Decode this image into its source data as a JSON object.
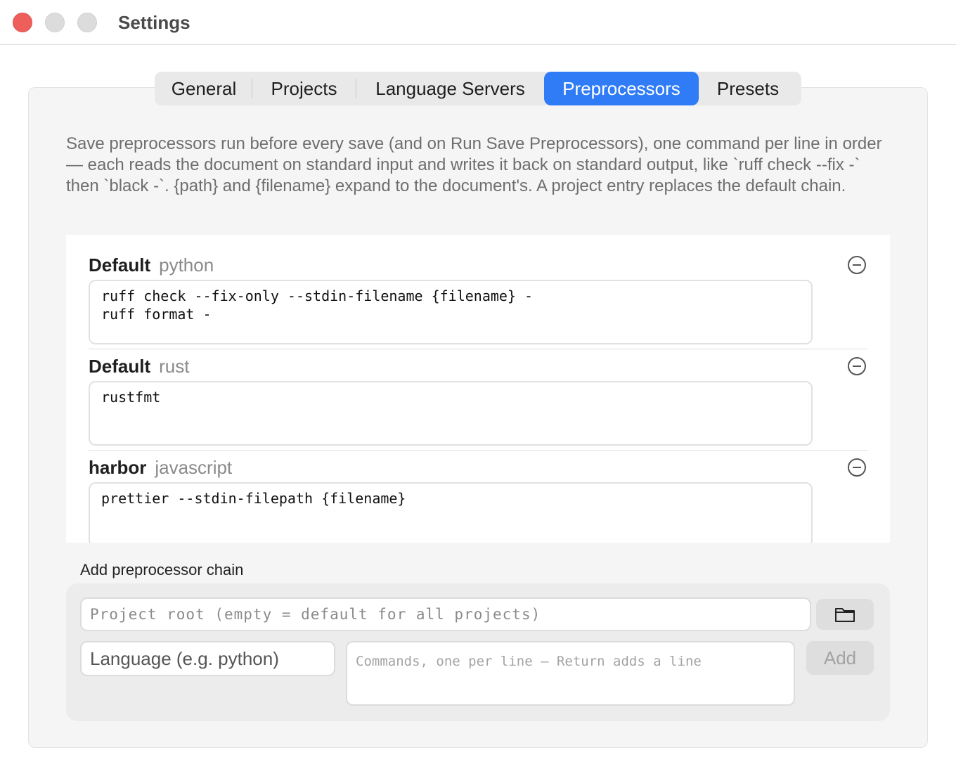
{
  "window": {
    "title": "Settings"
  },
  "tabs": [
    {
      "label": "General"
    },
    {
      "label": "Projects"
    },
    {
      "label": "Language Servers"
    },
    {
      "label": "Preprocessors"
    },
    {
      "label": "Presets"
    }
  ],
  "active_tab": "Preprocessors",
  "description": "Save preprocessors run before every save (and on Run Save Preprocessors), one command per line in order — each reads the document on standard input and writes it back on standard output, like `ruff check --fix -` then `black -`. {path} and {filename} expand to the document's. A project entry replaces the default chain.",
  "entries": [
    {
      "scope": "Default",
      "language": "python",
      "commands": "ruff check --fix-only --stdin-filename {filename} -\nruff format -"
    },
    {
      "scope": "Default",
      "language": "rust",
      "commands": "rustfmt"
    },
    {
      "scope": "harbor",
      "language": "javascript",
      "commands": "prettier --stdin-filepath {filename}"
    }
  ],
  "add_form": {
    "title": "Add preprocessor chain",
    "project_root_placeholder": "Project root (empty = default for all projects)",
    "language_placeholder": "Language (e.g. python)",
    "commands_placeholder": "Commands, one per line — Return adds a line",
    "add_label": "Add",
    "folder_icon": "folder-icon"
  },
  "colors": {
    "accent": "#2f7cf6",
    "close": "#ee5f5b"
  }
}
